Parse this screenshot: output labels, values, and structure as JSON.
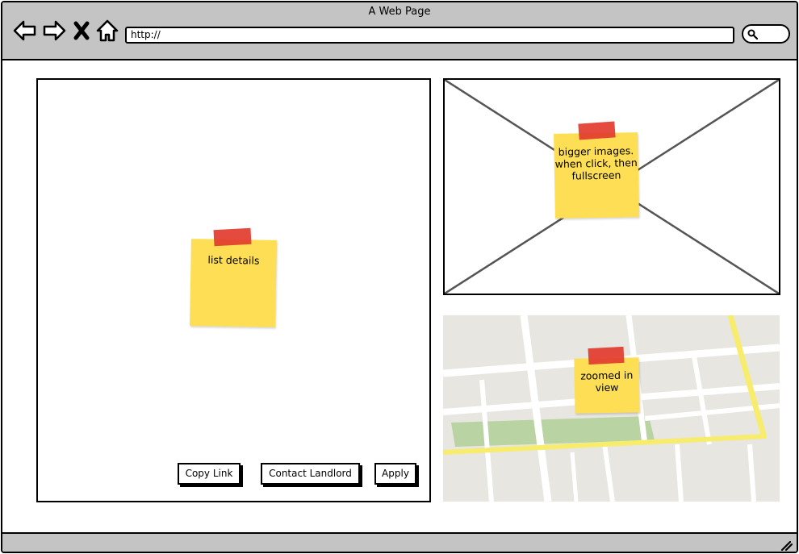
{
  "window": {
    "title": "A Web Page"
  },
  "toolbar": {
    "url_value": "http://",
    "icons": [
      "back-arrow-icon",
      "forward-arrow-icon",
      "close-x-icon",
      "home-icon",
      "search-icon"
    ]
  },
  "listing": {
    "buttons": {
      "copy_link": "Copy Link",
      "contact_landlord": "Contact Landlord",
      "apply": "Apply"
    }
  },
  "notes": {
    "list_details": "list details",
    "images": "bigger images. when click, then fullscreen",
    "map": "zoomed in view"
  },
  "colors": {
    "chrome": "#c4c4c4",
    "sticky_note": "#fdde55",
    "tape": "#e23b2e",
    "map_road_major": "#f7ec6b",
    "map_park": "#b9d3a3"
  }
}
